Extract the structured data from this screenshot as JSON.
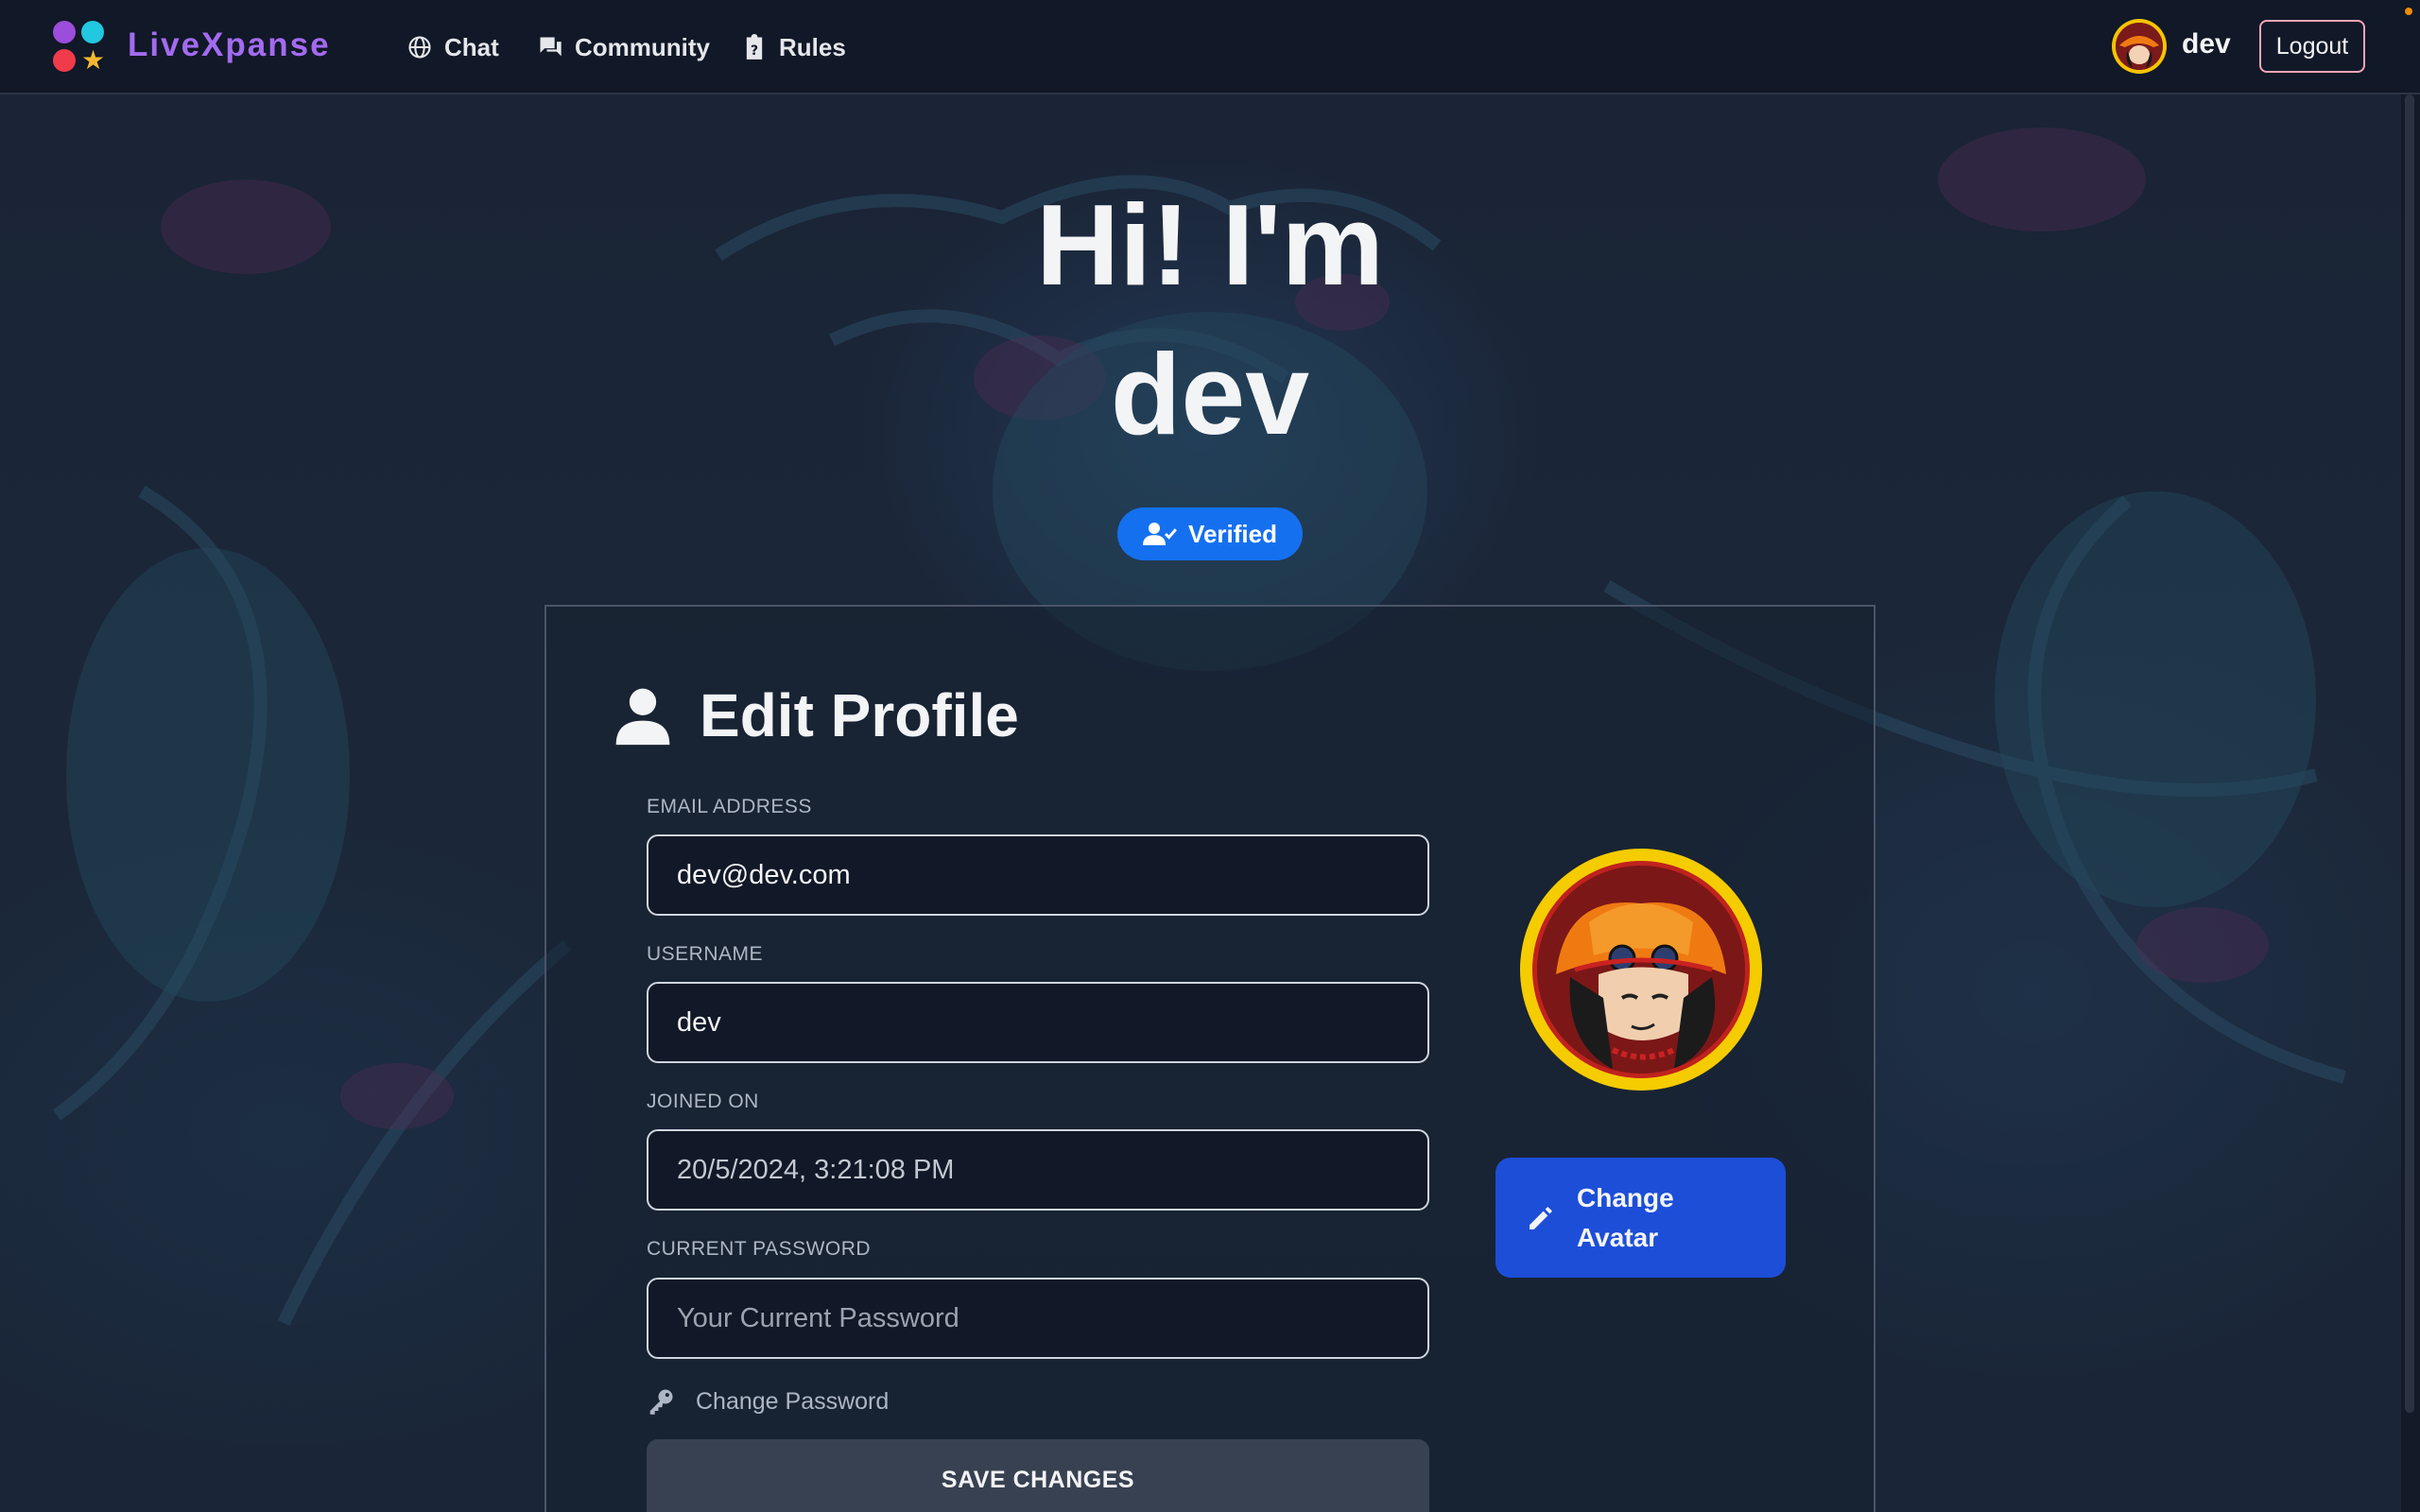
{
  "app": {
    "brand": "LiveXpanse",
    "nav": [
      {
        "label": "Chat",
        "icon": "globe-icon"
      },
      {
        "label": "Community",
        "icon": "chat-bubbles-icon"
      },
      {
        "label": "Rules",
        "icon": "clipboard-question-icon"
      }
    ],
    "user": {
      "name": "dev",
      "logout_label": "Logout"
    }
  },
  "hero": {
    "line1": "Hi! I'm",
    "line2": "dev",
    "badge": "Verified"
  },
  "profile": {
    "title": "Edit Profile",
    "email": {
      "label": "EMAIL ADDRESS",
      "value": "dev@dev.com"
    },
    "username": {
      "label": "USERNAME",
      "value": "dev"
    },
    "joined": {
      "label": "JOINED ON",
      "value": "20/5/2024, 3:21:08 PM"
    },
    "current_password": {
      "label": "CURRENT PASSWORD",
      "placeholder": "Your Current Password"
    },
    "change_password_label": "Change Password",
    "save_label": "SAVE CHANGES",
    "change_avatar_label": "Change Avatar"
  },
  "colors": {
    "nav_bg": "#111827",
    "brand": "#a36bf0",
    "verified": "#1570ef",
    "avatar_button": "#1d4ed8",
    "logout_border": "#f4a6b6",
    "avatar_ring": "#f5cc00"
  }
}
